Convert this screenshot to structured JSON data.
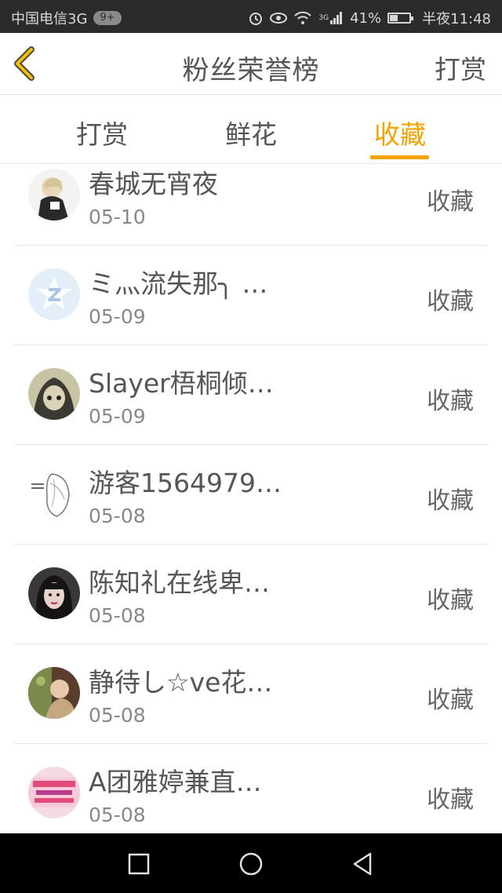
{
  "status_bar": {
    "carrier": "中国电信3G",
    "badge": "9+",
    "signal_label": "3G",
    "battery_pct": "41%",
    "battery_level": 0.41,
    "time": "半夜11:48",
    "icons": [
      "alarm-icon",
      "eye-icon",
      "wifi-icon",
      "signal-icon",
      "battery-icon"
    ]
  },
  "header": {
    "title": "粉丝荣誉榜",
    "back_icon": "chevron-left-icon",
    "action_label": "打赏",
    "accent": "#f4a300"
  },
  "tabs": [
    {
      "label": "打赏",
      "active": false
    },
    {
      "label": "鲜花",
      "active": false
    },
    {
      "label": "收藏",
      "active": true
    }
  ],
  "list": [
    {
      "name": "春城无宵夜",
      "date": "05-10",
      "type": "收藏",
      "avatar": "anime-girl-avatar"
    },
    {
      "name": "ミ灬流失那╮ …",
      "date": "05-09",
      "type": "收藏",
      "avatar": "qq-default-avatar"
    },
    {
      "name": "Slayer梧桐倾…",
      "date": "05-09",
      "type": "收藏",
      "avatar": "hooded-figure-avatar"
    },
    {
      "name": "游客1564979…",
      "date": "05-08",
      "type": "收藏",
      "avatar": "sketch-avatar"
    },
    {
      "name": "陈知礼在线卑…",
      "date": "05-08",
      "type": "收藏",
      "avatar": "portrait-avatar"
    },
    {
      "name": "静待し☆ve花…",
      "date": "05-08",
      "type": "收藏",
      "avatar": "photo-avatar"
    },
    {
      "name": "A团雅婷兼直…",
      "date": "05-08",
      "type": "收藏",
      "avatar": "text-banner-avatar"
    }
  ],
  "nav_bar": {
    "icons": [
      "recent-apps-icon",
      "home-icon",
      "back-triangle-icon"
    ]
  }
}
